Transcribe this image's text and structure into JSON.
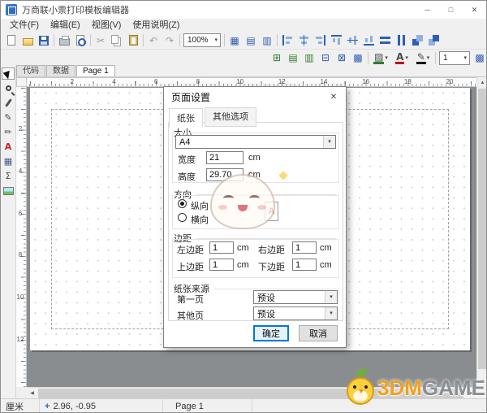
{
  "window": {
    "title": "万商联小票打印模板编辑器",
    "minimize": "─",
    "maximize": "□",
    "close": "✕"
  },
  "menu": {
    "file": "文件(F)",
    "edit": "编辑(E)",
    "view": "视图(V)",
    "help": "使用说明(Z)"
  },
  "toolbar": {
    "zoom": "100%",
    "line_width": "1"
  },
  "glyphs": {
    "cut": "✂",
    "undo": "↶",
    "redo": "↷",
    "dropdown": "▾",
    "grid": "▦",
    "snap": "▤",
    "guides": "▥",
    "table": "⊞",
    "table2": "▤",
    "table3": "▥",
    "row_del": "⊟",
    "cell_del": "⊠",
    "merge": "▩",
    "fill": "▨",
    "font": "A",
    "pen": "✎",
    "pencil_tool": "✎",
    "brush_tool": "✏",
    "text_tool": "A",
    "table_tool": "▦",
    "formula_tool": "Σ",
    "scroll_up": "▲",
    "scroll_down": "▼",
    "scroll_left": "◀",
    "scroll_right": "▶",
    "position": "+",
    "paper": "A"
  },
  "tabs": {
    "code": "代码",
    "data": "数据",
    "page": "Page 1"
  },
  "ruler": {
    "h": [
      "2",
      "4",
      "6",
      "8",
      "10",
      "12",
      "14",
      "16",
      "18",
      "20"
    ],
    "v": [
      "2",
      "4",
      "6",
      "8",
      "10",
      "12"
    ]
  },
  "dialog": {
    "title": "页面设置",
    "close": "✕",
    "tab_paper": "纸张",
    "tab_other": "其他选项",
    "size_label": "大小",
    "paper_size": "A4",
    "width_label": "宽度",
    "width_value": "21",
    "height_label": "高度",
    "height_value": "29.70",
    "unit": "cm",
    "orient_label": "方向",
    "portrait": "纵向",
    "landscape": "横向",
    "margin_label": "边距",
    "left_label": "左边距",
    "left_value": "1",
    "right_label": "右边距",
    "right_value": "1",
    "top_label": "上边距",
    "top_value": "1",
    "bottom_label": "下边距",
    "bottom_value": "1",
    "source_label": "纸张来源",
    "first_label": "第一页",
    "first_value": "预设",
    "other_label": "其他页",
    "other_value": "预设",
    "ok": "确定",
    "cancel": "取消"
  },
  "statusbar": {
    "unit": "厘米",
    "coords": "2.96, -0.95",
    "page": "Page 1"
  },
  "watermark": {
    "brand_left": "3DM",
    "brand_right": "GAME"
  }
}
